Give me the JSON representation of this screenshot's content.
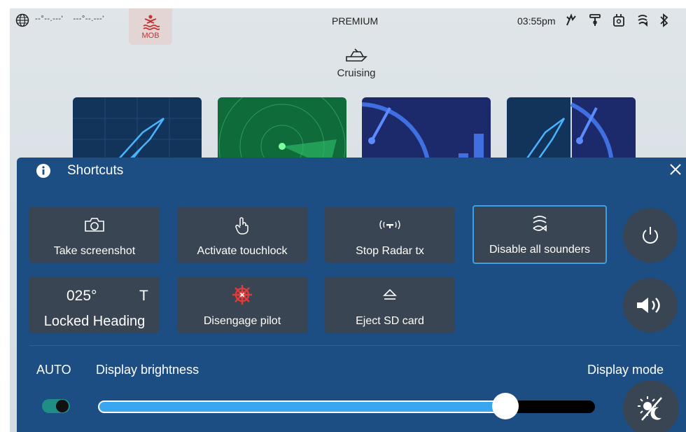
{
  "status_bar": {
    "coords_lat": "--°--.---'",
    "coords_lon": "---°--.---'",
    "mob_label": "MOB",
    "title": "PREMIUM",
    "time": "03:55pm",
    "icons": [
      "globe-icon",
      "autopilot-icon",
      "ais-icon",
      "radar-icon",
      "sonar-icon",
      "bluetooth-icon"
    ]
  },
  "mode": {
    "label": "Cruising",
    "icon": "boat-icon"
  },
  "shortcuts": {
    "title": "Shortcuts",
    "buttons": [
      {
        "label": "Take screenshot",
        "icon": "camera-icon"
      },
      {
        "label": "Activate touchlock",
        "icon": "touch-hand-icon"
      },
      {
        "label": "Stop Radar tx",
        "icon": "radar-tx-icon"
      },
      {
        "label": "Disable all sounders",
        "icon": "sounder-icon"
      },
      {
        "label": "Disengage pilot",
        "icon": "helm-icon"
      },
      {
        "label": "Eject SD card",
        "icon": "eject-icon"
      }
    ],
    "heading": {
      "value": "025°",
      "ref": "T",
      "label": "Locked Heading"
    }
  },
  "display": {
    "auto_label": "AUTO",
    "brightness_label": "Display brightness",
    "mode_label": "Display mode",
    "auto_enabled": true,
    "brightness_fraction": 0.82
  },
  "colors": {
    "panel": "#1c4e83",
    "button": "#394552",
    "accent": "#3aa0e8",
    "toggle_on": "#1f8f86",
    "mob_red": "#c73333"
  }
}
